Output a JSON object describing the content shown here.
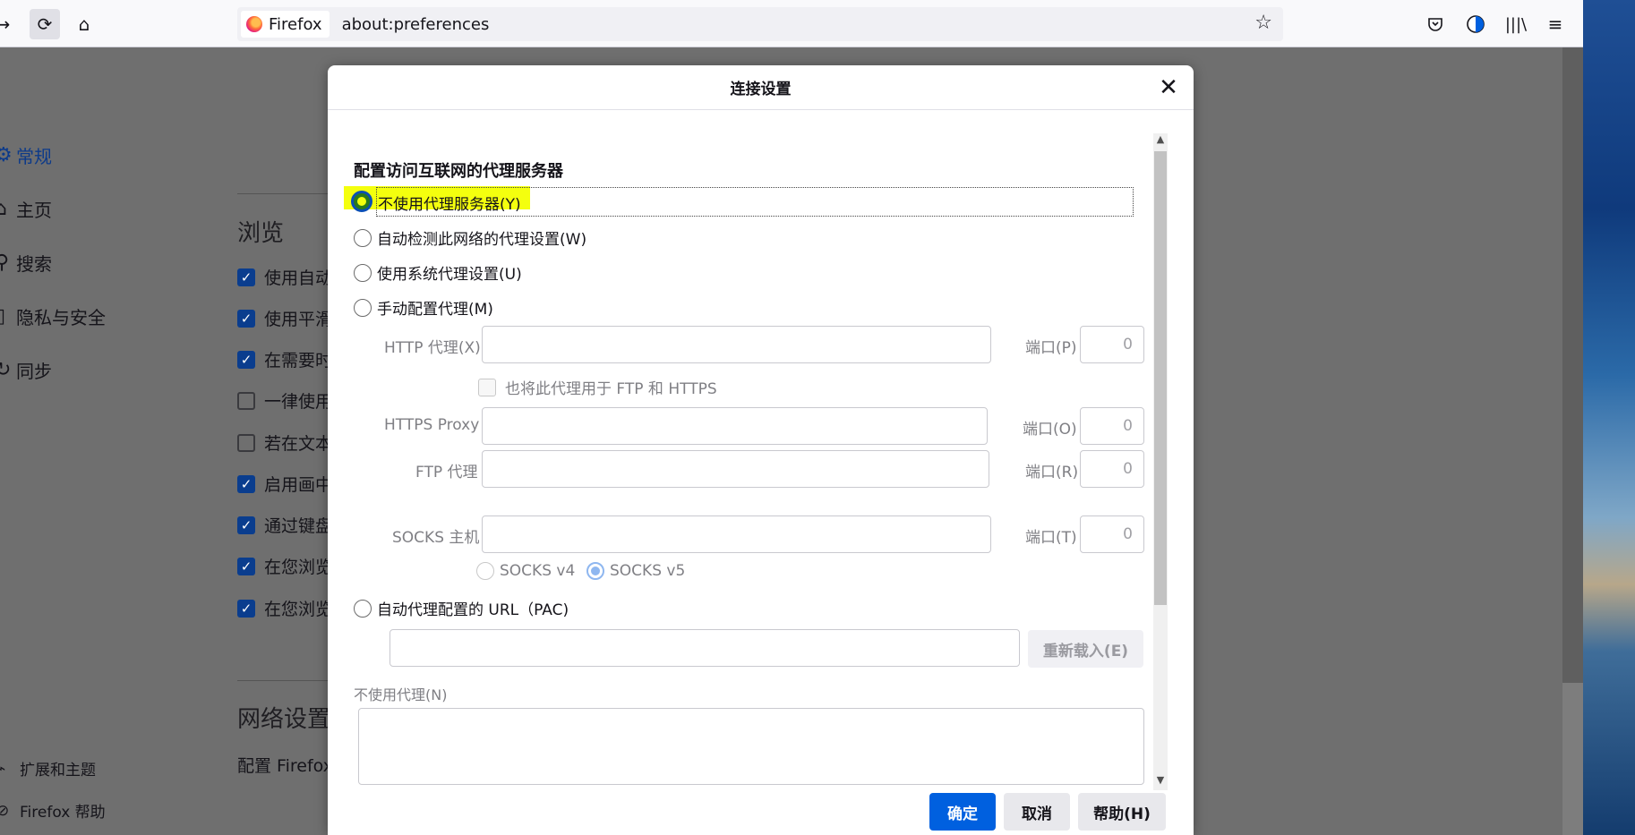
{
  "browser": {
    "identity_label": "Firefox",
    "url": "about:preferences",
    "icons": [
      "back-arrow-icon",
      "reload-icon",
      "home-icon",
      "star-icon",
      "pocket-icon",
      "contrast-icon",
      "library-icon",
      "menu-icon"
    ]
  },
  "sidebar": {
    "items": [
      {
        "icon": "gear-icon",
        "label": "常规",
        "selected": true
      },
      {
        "icon": "home-icon",
        "label": "主页"
      },
      {
        "icon": "search-icon",
        "label": "搜索"
      },
      {
        "icon": "lock-icon",
        "label": "隐私与安全"
      },
      {
        "icon": "sync-icon",
        "label": "同步"
      }
    ],
    "bottom": [
      {
        "icon": "puzzle-icon",
        "label": "扩展和主题"
      },
      {
        "icon": "help-icon",
        "label": "Firefox 帮助"
      }
    ]
  },
  "content": {
    "browsing_heading": "浏览",
    "rows": [
      {
        "label": "使用自动",
        "checked": true
      },
      {
        "label": "使用平滑",
        "checked": true
      },
      {
        "label": "在需要时",
        "checked": true
      },
      {
        "label": "一律使用",
        "checked": false
      },
      {
        "label": "若在文本",
        "checked": false
      },
      {
        "label": "启用画中",
        "checked": true
      },
      {
        "label": "通过键盘",
        "checked": true
      },
      {
        "label": "在您浏览",
        "checked": true
      },
      {
        "label": "在您浏览",
        "checked": true
      }
    ],
    "network_heading": "网络设置",
    "network_desc": "配置 Firefox"
  },
  "dialog": {
    "title": "连接设置",
    "section_title": "配置访问互联网的代理服务器",
    "options": {
      "no_proxy": "不使用代理服务器(Y)",
      "auto_detect": "自动检测此网络的代理设置(W)",
      "system": "使用系统代理设置(U)",
      "manual": "手动配置代理(M)",
      "pac": "自动代理配置的 URL（PAC)"
    },
    "selected_option": "no_proxy",
    "http_label": "HTTP 代理(X)",
    "port_label_p": "端口(P)",
    "http_port": "0",
    "also_use_label": "也将此代理用于 FTP 和 HTTPS",
    "https_label": "HTTPS Proxy",
    "port_label_o": "端口(O)",
    "https_port": "0",
    "ftp_label": "FTP 代理",
    "port_label_r": "端口(R)",
    "ftp_port": "0",
    "socks_label": "SOCKS 主机",
    "port_label_t": "端口(T)",
    "socks_port": "0",
    "socks_v4": "SOCKS v4",
    "socks_v5": "SOCKS v5",
    "reload_label": "重新载入(E)",
    "no_proxy_for_label": "不使用代理(N)",
    "ok_label": "确定",
    "cancel_label": "取消",
    "help_label": "帮助(H)",
    "highlight_color": "#f4ff0e",
    "accent_color": "#0060df"
  }
}
